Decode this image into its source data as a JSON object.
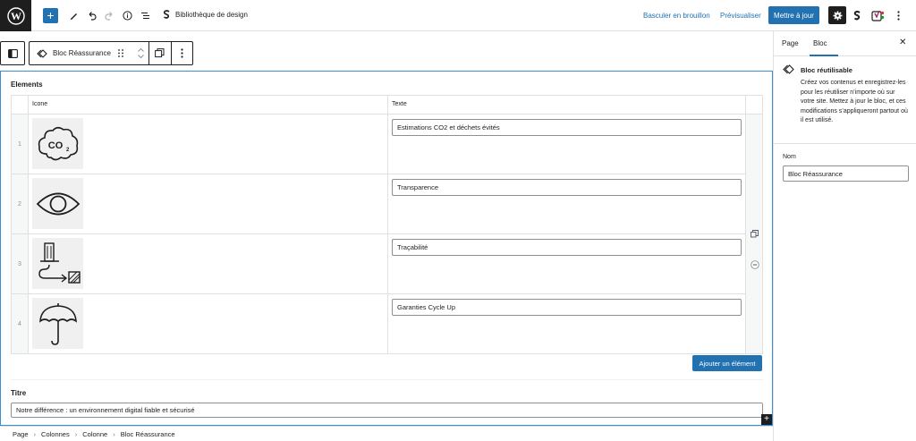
{
  "topbar": {
    "document_title": "Bibliothèque de design",
    "save_draft_label": "Basculer en brouillon",
    "preview_label": "Prévisualiser",
    "publish_label": "Mettre à jour"
  },
  "block_toolbar": {
    "block_name": "Bloc Réassurance"
  },
  "editor": {
    "elements_label": "Elements",
    "columns": [
      "Icone",
      "Texte"
    ],
    "rows": [
      {
        "index": "1",
        "icon": "co2-cloud-icon",
        "text": "Estimations CO2 et déchets évités"
      },
      {
        "index": "2",
        "icon": "eye-icon",
        "text": "Transparence"
      },
      {
        "index": "3",
        "icon": "traceability-icon",
        "text": "Traçabilité"
      },
      {
        "index": "4",
        "icon": "umbrella-icon",
        "text": "Garanties Cycle Up"
      }
    ],
    "add_row_label": "Ajouter un élément",
    "title_label": "Titre",
    "title_value": "Notre différence : un environnement digital fiable et sécurisé"
  },
  "breadcrumb": [
    "Page",
    "Colonnes",
    "Colonne",
    "Bloc Réassurance"
  ],
  "sidebar": {
    "tabs": [
      "Page",
      "Bloc"
    ],
    "active_tab": "Bloc",
    "block_title": "Bloc réutilisable",
    "block_description": "Créez vos contenus et enregistrez-les pour les réutiliser n’importe où sur votre site. Mettez à jour le bloc, et ces modifications s’appliqueront partout où il est utilisé.",
    "name_label": "Nom",
    "name_value": "Bloc Réassurance"
  },
  "colors": {
    "accent": "#2271b1",
    "selection_border": "#3c8fd6",
    "dark": "#1e1e1e"
  }
}
